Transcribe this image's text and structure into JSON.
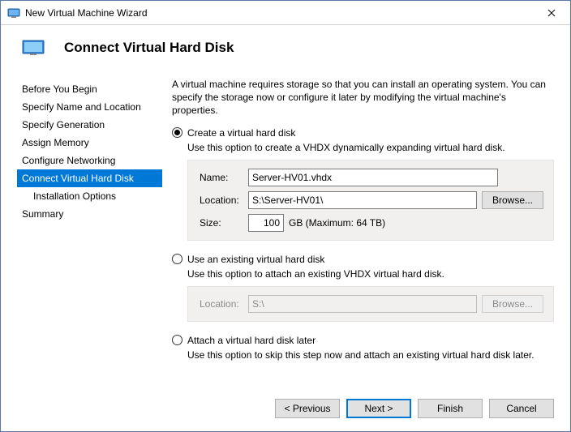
{
  "window": {
    "title": "New Virtual Machine Wizard"
  },
  "header": {
    "title": "Connect Virtual Hard Disk"
  },
  "sidebar": {
    "items": [
      {
        "label": "Before You Begin"
      },
      {
        "label": "Specify Name and Location"
      },
      {
        "label": "Specify Generation"
      },
      {
        "label": "Assign Memory"
      },
      {
        "label": "Configure Networking"
      },
      {
        "label": "Connect Virtual Hard Disk"
      },
      {
        "label": "Installation Options"
      },
      {
        "label": "Summary"
      }
    ]
  },
  "content": {
    "intro": "A virtual machine requires storage so that you can install an operating system. You can specify the storage now or configure it later by modifying the virtual machine's properties.",
    "opt_create": {
      "label": "Create a virtual hard disk",
      "desc": "Use this option to create a VHDX dynamically expanding virtual hard disk.",
      "name_label": "Name:",
      "name_value": "Server-HV01.vhdx",
      "location_label": "Location:",
      "location_value": "S:\\Server-HV01\\",
      "browse_label": "Browse...",
      "size_label": "Size:",
      "size_value": "100",
      "size_unit": "GB (Maximum: 64 TB)"
    },
    "opt_existing": {
      "label": "Use an existing virtual hard disk",
      "desc": "Use this option to attach an existing VHDX virtual hard disk.",
      "location_label": "Location:",
      "location_value": "S:\\",
      "browse_label": "Browse..."
    },
    "opt_later": {
      "label": "Attach a virtual hard disk later",
      "desc": "Use this option to skip this step now and attach an existing virtual hard disk later."
    }
  },
  "footer": {
    "previous": "< Previous",
    "next": "Next >",
    "finish": "Finish",
    "cancel": "Cancel"
  }
}
